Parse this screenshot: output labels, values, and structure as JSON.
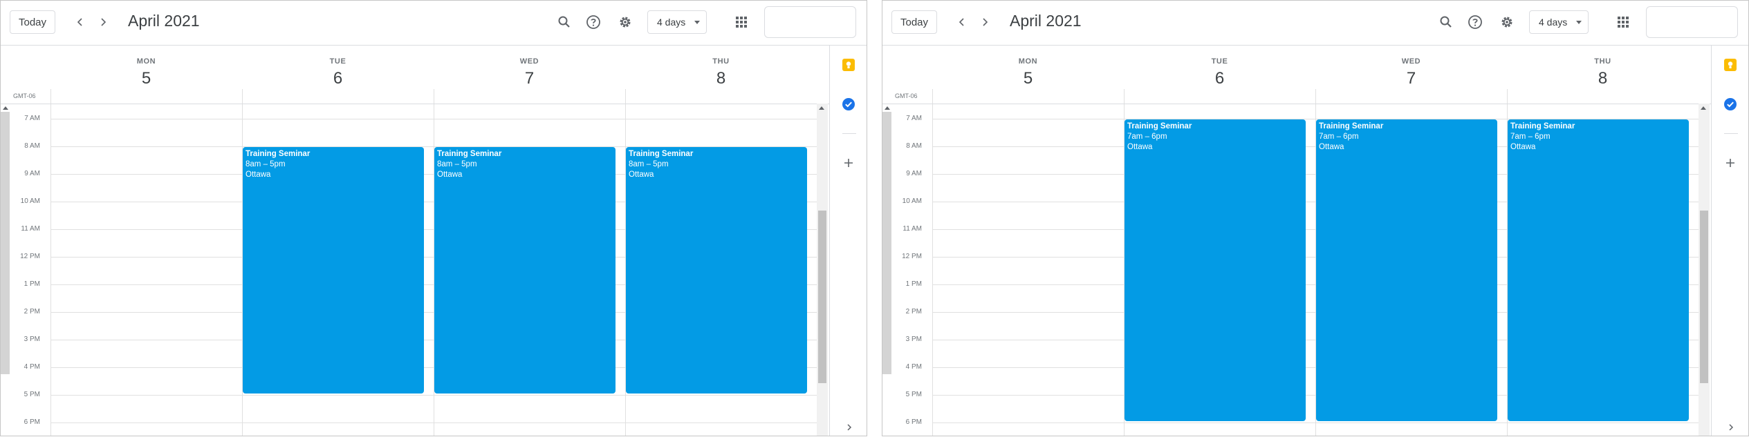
{
  "panels": [
    {
      "header": {
        "today_label": "Today",
        "month_title": "April 2021",
        "view_label": "4 days"
      },
      "timezone": "GMT-06",
      "days": [
        {
          "name": "MON",
          "number": "5"
        },
        {
          "name": "TUE",
          "number": "6"
        },
        {
          "name": "WED",
          "number": "7"
        },
        {
          "name": "THU",
          "number": "8"
        }
      ],
      "time_labels": [
        "7 AM",
        "8 AM",
        "9 AM",
        "10 AM",
        "11 AM",
        "12 PM",
        "1 PM",
        "2 PM",
        "3 PM",
        "4 PM",
        "5 PM",
        "6 PM"
      ],
      "events": [
        {
          "day": "TUE",
          "title": "Training Seminar",
          "time": "8am – 5pm",
          "location": "Ottawa"
        },
        {
          "day": "WED",
          "title": "Training Seminar",
          "time": "8am – 5pm",
          "location": "Ottawa"
        },
        {
          "day": "THU",
          "title": "Training Seminar",
          "time": "8am – 5pm",
          "location": "Ottawa"
        }
      ]
    },
    {
      "header": {
        "today_label": "Today",
        "month_title": "April 2021",
        "view_label": "4 days"
      },
      "timezone": "GMT-06",
      "days": [
        {
          "name": "MON",
          "number": "5"
        },
        {
          "name": "TUE",
          "number": "6"
        },
        {
          "name": "WED",
          "number": "7"
        },
        {
          "name": "THU",
          "number": "8"
        }
      ],
      "time_labels": [
        "7 AM",
        "8 AM",
        "9 AM",
        "10 AM",
        "11 AM",
        "12 PM",
        "1 PM",
        "2 PM",
        "3 PM",
        "4 PM",
        "5 PM",
        "6 PM"
      ],
      "events": [
        {
          "day": "TUE",
          "title": "Training Seminar",
          "time": "7am – 6pm",
          "location": "Ottawa"
        },
        {
          "day": "WED",
          "title": "Training Seminar",
          "time": "7am – 6pm",
          "location": "Ottawa"
        },
        {
          "day": "THU",
          "title": "Training Seminar",
          "time": "7am – 6pm",
          "location": "Ottawa"
        }
      ]
    }
  ],
  "icons": {
    "prev": "chevron-left-icon",
    "next": "chevron-right-icon",
    "search": "search-icon",
    "help": "help-icon",
    "settings": "gear-icon",
    "apps": "apps-grid-icon",
    "keep": "keep-icon",
    "tasks": "tasks-icon",
    "add": "plus-icon",
    "collapse": "chevron-right-icon"
  },
  "colors": {
    "event": "#039be5",
    "keep": "#fbbc04",
    "tasks": "#1a73e8"
  }
}
